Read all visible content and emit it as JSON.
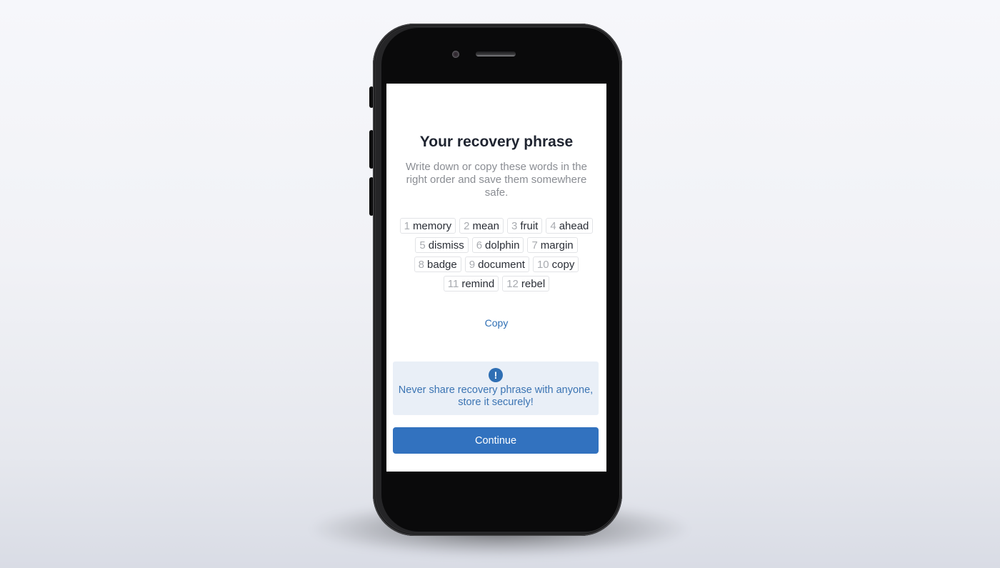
{
  "screen": {
    "title": "Your recovery phrase",
    "subtitle": "Write down or copy these words in the right order and save them somewhere safe.",
    "recovery_words": [
      {
        "index": "1",
        "word": "memory"
      },
      {
        "index": "2",
        "word": "mean"
      },
      {
        "index": "3",
        "word": "fruit"
      },
      {
        "index": "4",
        "word": "ahead"
      },
      {
        "index": "5",
        "word": "dismiss"
      },
      {
        "index": "6",
        "word": "dolphin"
      },
      {
        "index": "7",
        "word": "margin"
      },
      {
        "index": "8",
        "word": "badge"
      },
      {
        "index": "9",
        "word": "document"
      },
      {
        "index": "10",
        "word": "copy"
      },
      {
        "index": "11",
        "word": "remind"
      },
      {
        "index": "12",
        "word": "rebel"
      }
    ],
    "copy_label": "Copy",
    "warning": {
      "icon": "exclamation-circle-icon",
      "icon_glyph": "!",
      "text": "Never share recovery phrase with anyone, store it securely!"
    },
    "continue_label": "Continue"
  },
  "colors": {
    "accent": "#3272bf",
    "warning_bg": "#e9eff7",
    "warning_text": "#3b74b3",
    "title": "#1f2430",
    "subtitle": "#8a8d93"
  }
}
